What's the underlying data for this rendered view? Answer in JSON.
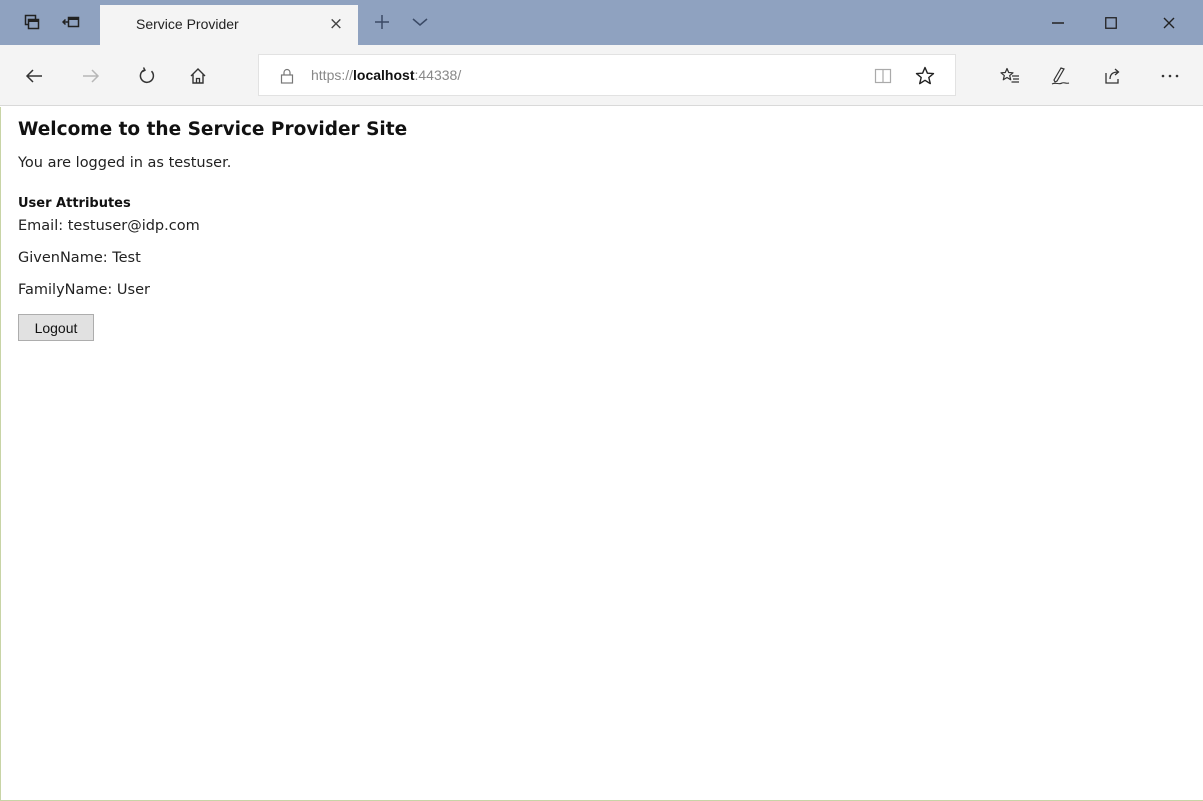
{
  "browser": {
    "tab": {
      "title": "Service Provider",
      "close_glyph": "×"
    },
    "address": {
      "scheme": "https://",
      "host": "localhost",
      "port": ":44338/"
    },
    "caption": {
      "minimize": "minimize-icon",
      "maximize": "maximize-icon",
      "close": "close-icon"
    },
    "colors": {
      "tabbar": "#8fa2c0",
      "chrome": "#f4f4f4"
    }
  },
  "page": {
    "title": "Welcome to the Service Provider Site",
    "login_text": "You are logged in as testuser.",
    "attributes_heading": "User Attributes",
    "attributes": [
      {
        "text": "Email: testuser@idp.com"
      },
      {
        "text": "GivenName: Test"
      },
      {
        "text": "FamilyName: User"
      }
    ],
    "logout_label": "Logout"
  }
}
